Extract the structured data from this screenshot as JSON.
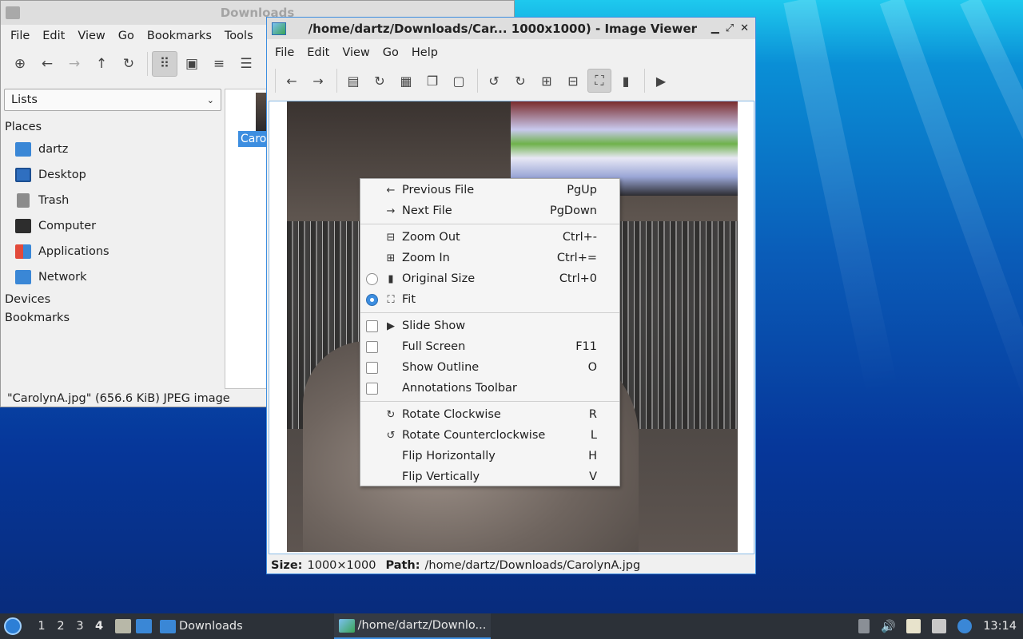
{
  "file_manager": {
    "title": "Downloads",
    "menu": [
      "File",
      "Edit",
      "View",
      "Go",
      "Bookmarks",
      "Tools"
    ],
    "toolbar_icons": [
      "new-tab-icon",
      "back-arrow-icon",
      "forward-arrow-icon",
      "up-arrow-icon",
      "reload-icon",
      "icon-view-icon",
      "thumbnail-view-icon",
      "compact-view-icon",
      "detailed-list-view-icon"
    ],
    "side_combo": "Lists",
    "places_heading": "Places",
    "places": [
      "dartz",
      "Desktop",
      "Trash",
      "Computer",
      "Applications",
      "Network"
    ],
    "devices_heading": "Devices",
    "bookmarks_heading": "Bookmarks",
    "selected_file_label": "Caro",
    "status": "\"CarolynA.jpg\" (656.6 KiB) JPEG image"
  },
  "image_viewer": {
    "title": "/home/dartz/Downloads/Car... 1000x1000) - Image Viewer",
    "menu": [
      "File",
      "Edit",
      "View",
      "Go",
      "Help"
    ],
    "status": {
      "size_label": "Size:",
      "size_value": "1000×1000",
      "path_label": "Path:",
      "path_value": "/home/dartz/Downloads/CarolynA.jpg"
    }
  },
  "context_menu": {
    "groups": [
      [
        {
          "icon": "left-arrow-icon",
          "glyph": "←",
          "check": "none",
          "label": "Previous File",
          "accel": "PgUp"
        },
        {
          "icon": "right-arrow-icon",
          "glyph": "→",
          "check": "none",
          "label": "Next File",
          "accel": "PgDown"
        }
      ],
      [
        {
          "icon": "zoom-out-icon",
          "glyph": "⊟",
          "check": "none",
          "label": "Zoom Out",
          "accel": "Ctrl+-"
        },
        {
          "icon": "zoom-in-icon",
          "glyph": "⊞",
          "check": "none",
          "label": "Zoom In",
          "accel": "Ctrl+="
        },
        {
          "icon": "original-size-icon",
          "glyph": "▮",
          "check": "radio-off",
          "label": "Original Size",
          "accel": "Ctrl+0"
        },
        {
          "icon": "fit-icon",
          "glyph": "⛶",
          "check": "radio-on",
          "label": "Fit",
          "accel": ""
        }
      ],
      [
        {
          "icon": "play-icon",
          "glyph": "▶",
          "check": "box",
          "label": "Slide Show",
          "accel": ""
        },
        {
          "icon": "",
          "glyph": "",
          "check": "box",
          "label": "Full Screen",
          "accel": "F11"
        },
        {
          "icon": "",
          "glyph": "",
          "check": "box",
          "label": "Show Outline",
          "accel": "O"
        },
        {
          "icon": "",
          "glyph": "",
          "check": "box",
          "label": "Annotations Toolbar",
          "accel": ""
        }
      ],
      [
        {
          "icon": "rotate-clockwise-icon",
          "glyph": "↻",
          "check": "none",
          "label": "Rotate Clockwise",
          "accel": "R"
        },
        {
          "icon": "rotate-counterclockwise-icon",
          "glyph": "↺",
          "check": "none",
          "label": "Rotate Counterclockwise",
          "accel": "L"
        },
        {
          "icon": "",
          "glyph": "",
          "check": "none",
          "label": "Flip Horizontally",
          "accel": "H"
        },
        {
          "icon": "",
          "glyph": "",
          "check": "none",
          "label": "Flip Vertically",
          "accel": "V"
        }
      ]
    ]
  },
  "taskbar": {
    "workspaces": [
      "1",
      "2",
      "3",
      "4"
    ],
    "current_workspace": "4",
    "tasks": [
      {
        "label": "Downloads",
        "active": false
      },
      {
        "label": "/home/dartz/Downlo...",
        "active": true
      }
    ],
    "clock": "13:14"
  }
}
